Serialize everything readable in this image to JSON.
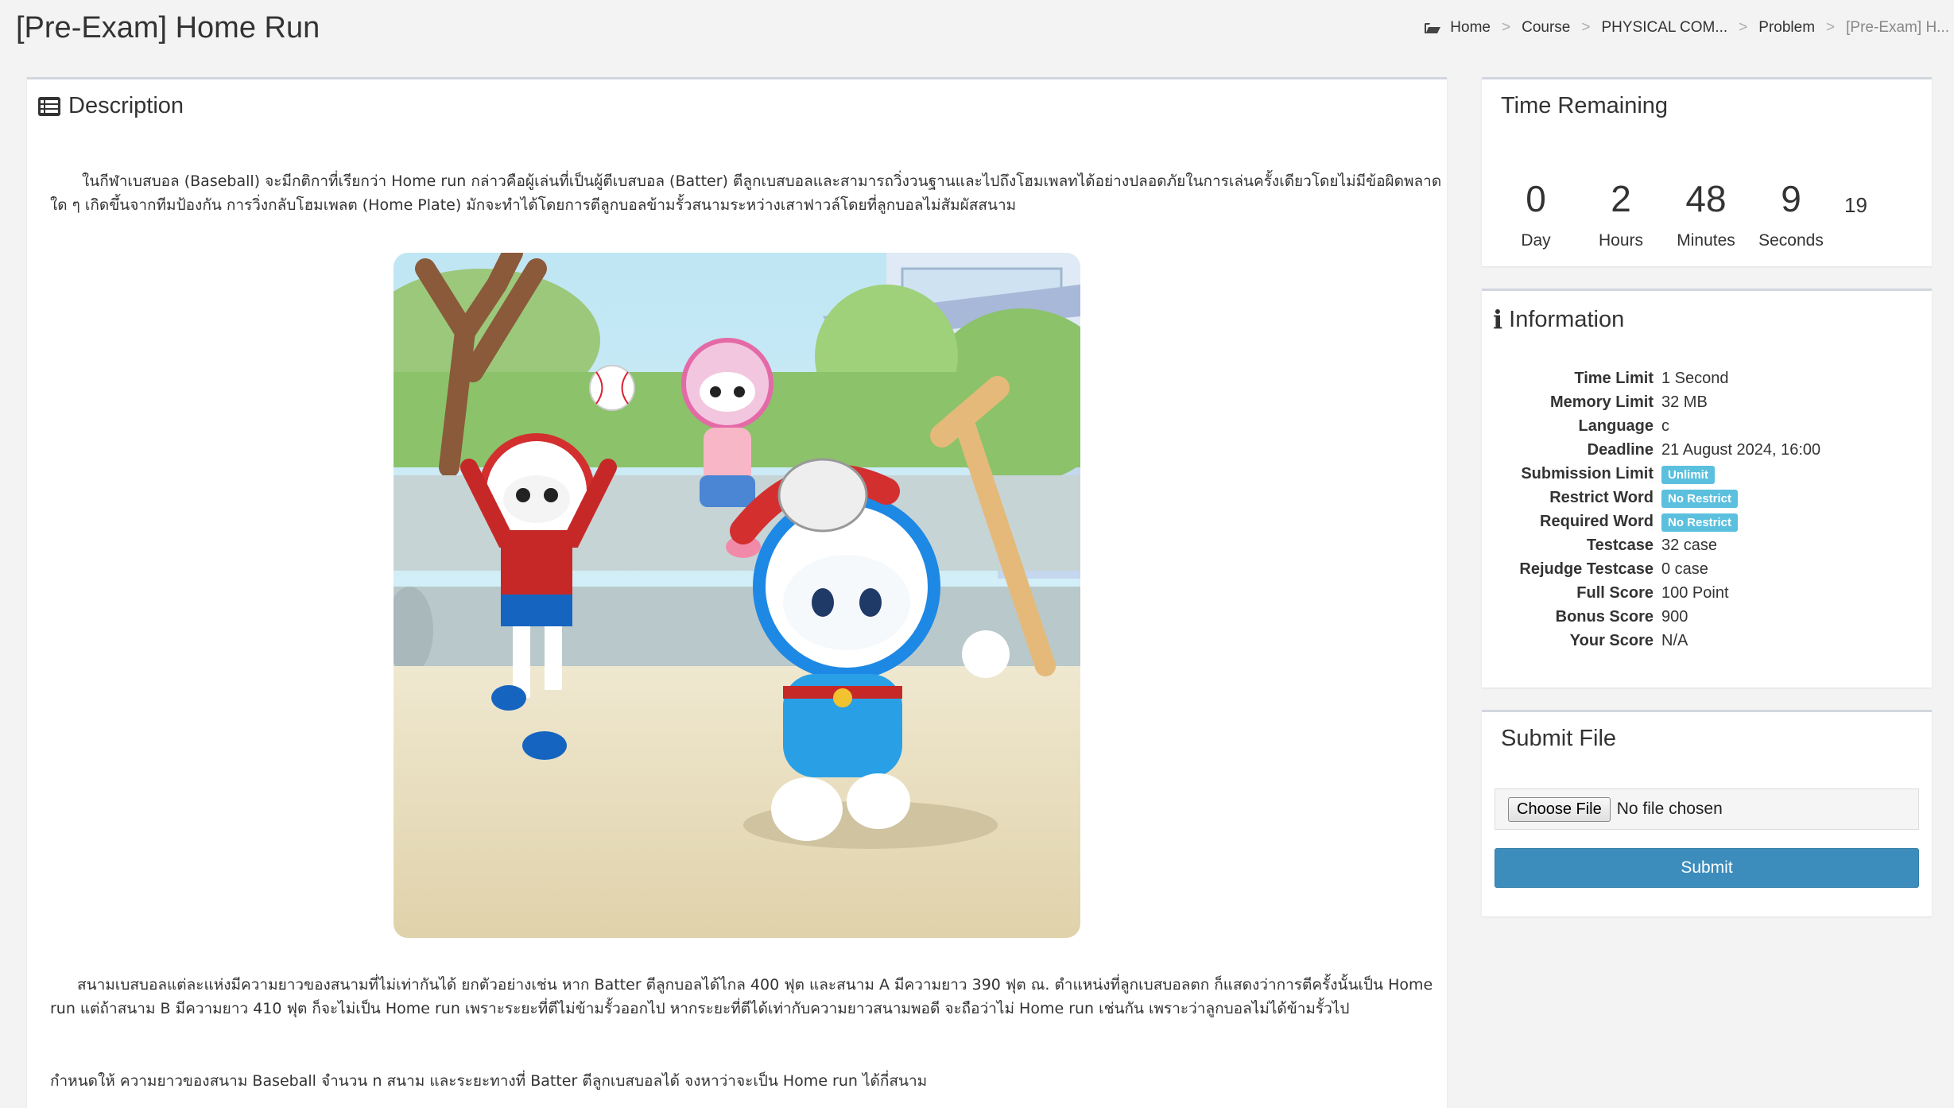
{
  "page": {
    "title": "[Pre-Exam] Home Run"
  },
  "breadcrumb": {
    "items": [
      "Home",
      "Course",
      "PHYSICAL COM...",
      "Problem",
      "[Pre-Exam] H..."
    ]
  },
  "description": {
    "heading": "Description",
    "paragraph1": "ในกีฬาเบสบอล (Baseball) จะมีกติกาที่เรียกว่า Home run กล่าวคือผู้เล่นที่เป็นผู้ตีเบสบอล (Batter) ตีลูกเบสบอลและสามารถวิ่งวนฐานและไปถึงโฮมเพลทได้อย่างปลอดภัยในการเล่นครั้งเดียวโดยไม่มีข้อผิดพลาดใด ๆ เกิดขึ้นจากทีมป้องกัน การวิ่งกลับโฮมเพลต (Home Plate) มักจะทำได้โดยการตีลูกบอลข้ามรั้วสนามระหว่างเสาฟาวล์โดยที่ลูกบอลไม่สัมผัสสนาม",
    "paragraph2": "สนามเบสบอลแต่ละแห่งมีความยาวของสนามที่ไม่เท่ากันได้ ยกตัวอย่างเช่น หาก Batter ตีลูกบอลได้ไกล 400 ฟุต และสนาม A มีความยาว 390 ฟุต ณ. ตำแหน่งที่ลูกเบสบอลตก ก็แสดงว่าการตีครั้งนั้นเป็น  Home run แต่ถ้าสนาม B มีความยาว 410 ฟุต ก็จะไม่เป็น Home run เพราะระยะที่ตีไม่ข้ามรั้วออกไป หากระยะที่ตีได้เท่ากับความยาวสนามพอดี จะถือว่าไม่ Home run เช่นกัน เพราะว่าลูกบอลไม่ได้ข้ามรั้วไป",
    "paragraph3": "กำหนดให้ ความยาวของสนาม Baseball จำนวน n สนาม และระยะทางที่ Batter ตีลูกเบสบอลได้ จงหาว่าจะเป็น Home run ได้กี่สนาม"
  },
  "timer": {
    "heading": "Time Remaining",
    "day": "0",
    "day_label": "Day",
    "hours": "2",
    "hours_label": "Hours",
    "minutes": "48",
    "minutes_label": "Minutes",
    "seconds": "9",
    "seconds_label": "Seconds",
    "fraction": "19"
  },
  "info": {
    "heading": "Information",
    "rows": [
      {
        "key": "Time Limit",
        "value": "1 Second"
      },
      {
        "key": "Memory Limit",
        "value": "32 MB"
      },
      {
        "key": "Language",
        "value": "c"
      },
      {
        "key": "Deadline",
        "value": "21 August 2024, 16:00"
      },
      {
        "key": "Submission Limit",
        "value": "Unlimit"
      },
      {
        "key": "Restrict Word",
        "value": "No Restrict"
      },
      {
        "key": "Required Word",
        "value": "No Restrict"
      },
      {
        "key": "Testcase",
        "value": "32 case"
      },
      {
        "key": "Rejudge Testcase",
        "value": "0 case"
      },
      {
        "key": "Full Score",
        "value": "100 Point"
      },
      {
        "key": "Bonus Score",
        "value": "900"
      },
      {
        "key": "Your Score",
        "value": "N/A"
      }
    ]
  },
  "submit": {
    "heading": "Submit File",
    "choose_label": "Choose File",
    "no_file_text": "No file chosen",
    "submit_label": "Submit"
  },
  "colors": {
    "primary": "#3c8dbc",
    "badge": "#5bc0de",
    "background": "#f3f3f3"
  }
}
